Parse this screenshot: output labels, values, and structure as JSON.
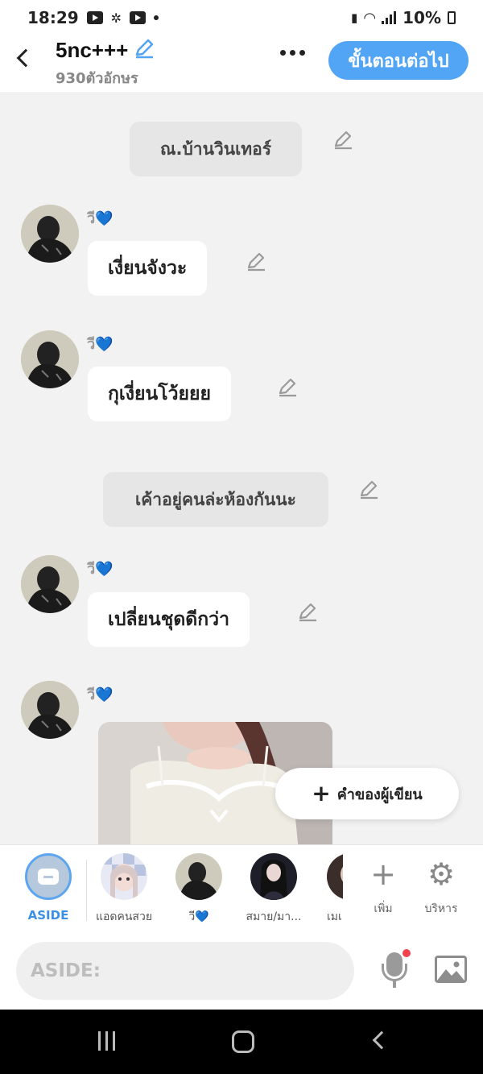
{
  "status_bar": {
    "time": "18:29",
    "battery": "10%"
  },
  "header": {
    "title": "5nc+++",
    "char_count": "930ตัวอักษร",
    "next_label": "ขั้นตอนต่อไป"
  },
  "messages": [
    {
      "type": "narration",
      "text": "ณ.บ้านวินเทอร์"
    },
    {
      "type": "dialogue",
      "speaker": "วี💙",
      "text": "เงี่ยนจังวะ"
    },
    {
      "type": "dialogue",
      "speaker": "วี💙",
      "text": "กุเงี่ยนโว้ยยย"
    },
    {
      "type": "narration",
      "text": "เค้าอยู่คนล่ะห้องกันนะ"
    },
    {
      "type": "dialogue",
      "speaker": "วี💙",
      "text": "เปลี่ยนชุดดีกว่า"
    },
    {
      "type": "image",
      "speaker": "วี💙"
    }
  ],
  "author_note_label": "คำของผู้เขียน",
  "characters": [
    {
      "label": "ASIDE"
    },
    {
      "label": "แอดคนสวย"
    },
    {
      "label": "วี💙"
    },
    {
      "label": "สมาย/มา..."
    },
    {
      "label": "เมเ"
    }
  ],
  "tools": {
    "add_label": "เพิ่ม",
    "manage_label": "บริหาร"
  },
  "input": {
    "placeholder": "ASIDE:",
    "value": ""
  },
  "colors": {
    "accent": "#52a4f5",
    "background": "#f2f2f2",
    "narration_bg": "#e6e6e6"
  }
}
